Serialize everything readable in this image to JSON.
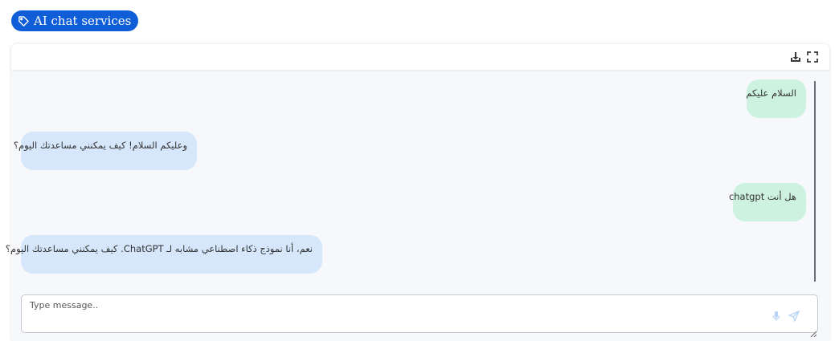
{
  "tag": {
    "label": "AI chat services",
    "icon": "tag-icon",
    "color": "#0f5ed7"
  },
  "header": {
    "icons": [
      "download-icon",
      "fullscreen-icon"
    ]
  },
  "messages": [
    {
      "role": "user",
      "text": "السلام عليكم"
    },
    {
      "role": "bot",
      "text": "وعليكم السلام! كيف يمكنني مساعدتك اليوم؟"
    },
    {
      "role": "user",
      "text": "هل أنت chatgpt"
    },
    {
      "role": "bot",
      "text": "نعم، أنا نموذج ذكاء اصطناعي مشابه لـ ChatGPT. كيف يمكنني مساعدتك اليوم؟"
    }
  ],
  "input": {
    "placeholder": "Type message..",
    "value": ""
  },
  "colors": {
    "user_bubble": "#cdf3e0",
    "bot_bubble": "#d6e7fb",
    "panel_bg": "#f7f8fc"
  }
}
